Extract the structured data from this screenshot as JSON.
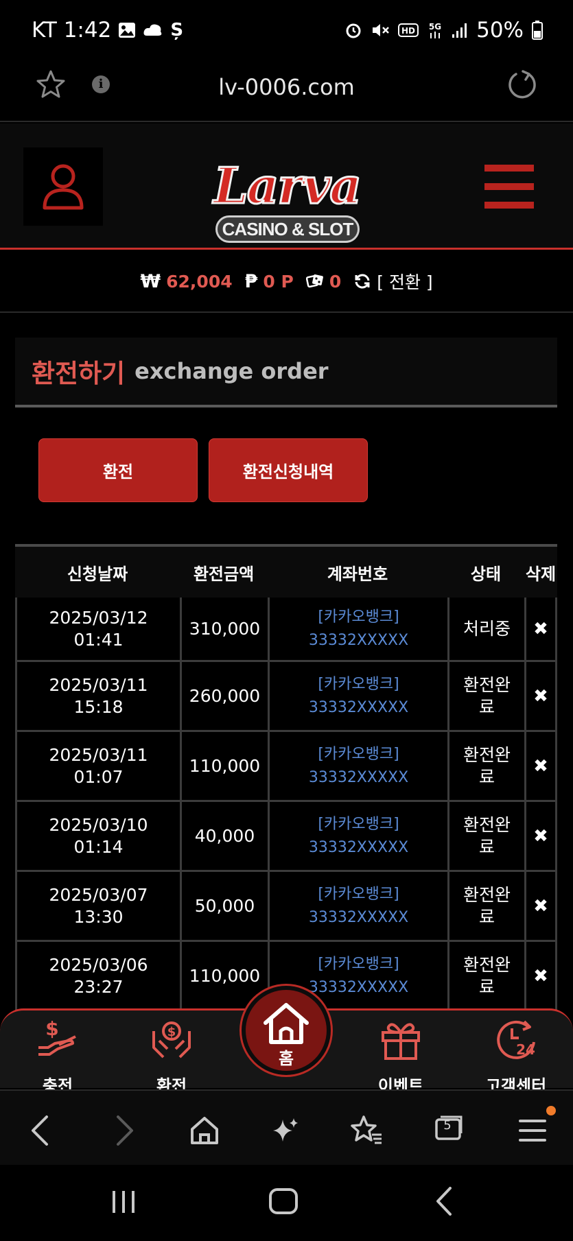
{
  "status_bar": {
    "carrier_time": "KT 1:42",
    "battery": "50%",
    "left_icons": [
      "gallery-icon",
      "cloud-icon",
      "s-icon"
    ],
    "right_icons": [
      "alarm-icon",
      "mute-icon",
      "hd-icon",
      "5g-icon",
      "signal-icon",
      "battery-icon"
    ]
  },
  "browser": {
    "url": "lv-0006.com",
    "info_glyph": "i"
  },
  "header": {
    "logo_main": "Larva",
    "logo_sub": "CASINO & SLOT"
  },
  "balance": {
    "won_symbol": "₩",
    "won_value": "62,004",
    "point_symbol": "₱",
    "point_value": "0 P",
    "chip_value": "0",
    "switch_label": "[ 전환 ]"
  },
  "section": {
    "title": "환전하기",
    "subtitle": "exchange order"
  },
  "buttons": {
    "exchange": "환전",
    "history": "환전신청내역"
  },
  "table": {
    "headers": [
      "신청날짜",
      "환전금액",
      "계좌번호",
      "상태",
      "삭제"
    ],
    "delete_glyph": "✖",
    "rows": [
      {
        "date": "2025/03/12",
        "time": "01:41",
        "amount": "310,000",
        "bank": "[카카오뱅크]",
        "account": "33332XXXXX",
        "status": "처리중"
      },
      {
        "date": "2025/03/11",
        "time": "15:18",
        "amount": "260,000",
        "bank": "[카카오뱅크]",
        "account": "33332XXXXX",
        "status": "환전완료"
      },
      {
        "date": "2025/03/11",
        "time": "01:07",
        "amount": "110,000",
        "bank": "[카카오뱅크]",
        "account": "33332XXXXX",
        "status": "환전완료"
      },
      {
        "date": "2025/03/10",
        "time": "01:14",
        "amount": "40,000",
        "bank": "[카카오뱅크]",
        "account": "33332XXXXX",
        "status": "환전완료"
      },
      {
        "date": "2025/03/07",
        "time": "13:30",
        "amount": "50,000",
        "bank": "[카카오뱅크]",
        "account": "33332XXXXX",
        "status": "환전완료"
      },
      {
        "date": "2025/03/06",
        "time": "23:27",
        "amount": "110,000",
        "bank": "[카카오뱅크]",
        "account": "33332XXXXX",
        "status": "환전완료"
      }
    ]
  },
  "site_nav": {
    "deposit": "충전",
    "withdraw": "환전",
    "home": "홈",
    "event": "이벤트",
    "support": "고객센터",
    "support_badge": "24"
  },
  "browser_toolbar": {
    "tabs_count": "5"
  },
  "colors": {
    "accent": "#c9302c",
    "accent_text": "#e05a52",
    "link": "#5b8bd6",
    "background": "#000000"
  }
}
